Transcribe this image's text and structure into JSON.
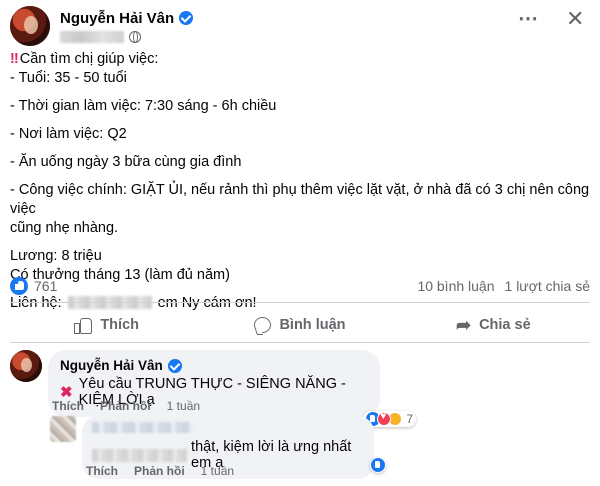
{
  "post": {
    "author": "Nguyễn Hải Vân",
    "more_icon": "⋯",
    "close_icon": "✕",
    "lines": [
      "Cần tìm chị giúp việc:",
      "- Tuổi: 35 - 50 tuổi",
      "- Thời gian làm việc: 7:30 sáng - 6h chiều",
      "- Nơi làm việc: Q2",
      "- Ăn uống ngày 3 bữa cùng gia đình",
      "- Công việc chính: GIẶT ỦI, nếu rảnh thì phụ thêm việc lặt vặt, ở nhà đã có 3 chị nên công việc",
      "cũng nhẹ nhàng.",
      "Lương: 8 triệu",
      "Có thưởng tháng 13 (làm đủ năm)",
      "Liên hệ:",
      "em Ny cám ơn!"
    ]
  },
  "stats": {
    "likes": "761",
    "comments": "10 bình luận",
    "shares": "1 lượt chia sẻ"
  },
  "actions": {
    "like": "Thích",
    "comment": "Bình luận",
    "share": "Chia sẻ"
  },
  "comments": [
    {
      "author": "Nguyễn Hải Vân",
      "text": "Yêu cầu TRUNG THỰC - SIÊNG NĂNG - KIỆM LỜI ạ",
      "reaction_count": "7",
      "like_label": "Thích",
      "reply_label": "Phản hồi",
      "time": "1 tuần"
    },
    {
      "text": "thật, kiệm lời là ưng nhất em ạ",
      "like_label": "Thích",
      "reply_label": "Phản hồi",
      "time": "1 tuần"
    }
  ],
  "colors": {
    "brand": "#1877f2",
    "text": "#050505",
    "secondary": "#65676b",
    "bubble": "#f0f2f5",
    "alert": "#e0245e"
  },
  "icons": [
    "verified-icon",
    "globe-icon",
    "more-icon",
    "close-icon",
    "like-icon",
    "comment-icon",
    "share-icon",
    "cross-icon",
    "love-icon"
  ]
}
